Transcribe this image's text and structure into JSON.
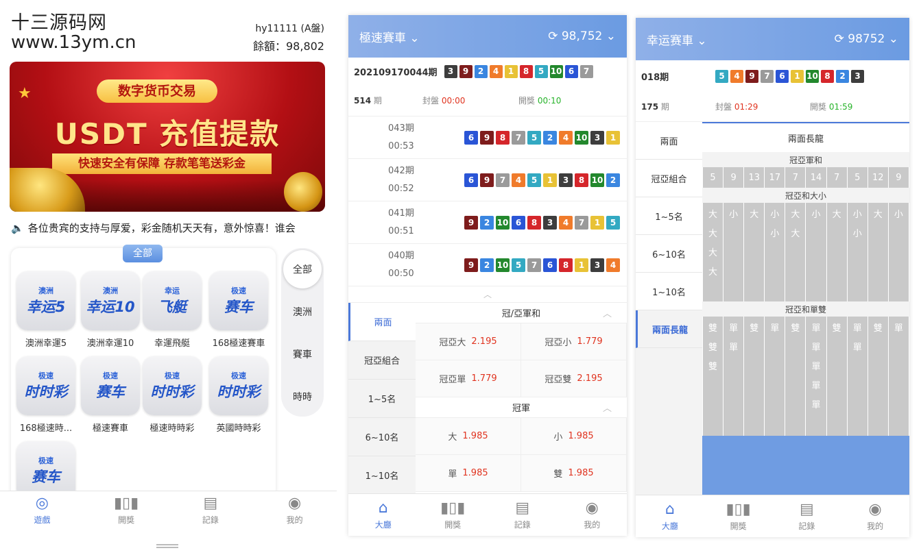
{
  "p1": {
    "wm_line1": "十三源码网",
    "wm_line2": "www.13ym.cn",
    "username": "hy11111 (A盤)",
    "balance": "餘額：98,802",
    "banner": {
      "tag": "数字货币交易",
      "title": "USDT 充值提款",
      "sub": "快速安全有保障 存款笔笔送彩金"
    },
    "notice": "各位贵宾的支持与厚爱，彩金随机天天有，意外惊喜！谁会",
    "all_badge": "全部",
    "games": [
      {
        "t1": "澳洲",
        "t2": "幸运5",
        "label": "澳洲幸運5"
      },
      {
        "t1": "澳洲",
        "t2": "幸运10",
        "label": "澳洲幸運10"
      },
      {
        "t1": "幸运",
        "t2": "飞艇",
        "label": "幸運飛艇"
      },
      {
        "t1": "极速",
        "t2": "赛车",
        "label": "168極速賽車"
      },
      {
        "t1": "极速",
        "t2": "时时彩",
        "label": "168極速時..."
      },
      {
        "t1": "极速",
        "t2": "赛车",
        "label": "極速賽車"
      },
      {
        "t1": "极速",
        "t2": "时时彩",
        "label": "極速時時彩"
      },
      {
        "t1": "极速",
        "t2": "时时彩",
        "label": "英國時時彩"
      },
      {
        "t1": "极速",
        "t2": "赛车",
        "label": ""
      }
    ],
    "rnav": [
      "全部",
      "澳洲",
      "賽車",
      "時時"
    ],
    "tabs": [
      "遊戲",
      "開獎",
      "記錄",
      "我的"
    ]
  },
  "p2": {
    "title": "極速賽車",
    "balance": "98,752",
    "period": "202109170044期",
    "draw": [
      3,
      9,
      2,
      4,
      1,
      8,
      5,
      10,
      6,
      7
    ],
    "cur_period": "514",
    "cur_unit": "期",
    "close_label": "封盤",
    "close_time": "00:00",
    "open_label": "開獎",
    "open_time": "00:10",
    "history": [
      {
        "p": "043期",
        "t": "00:53",
        "n": [
          6,
          9,
          8,
          7,
          5,
          2,
          4,
          10,
          3,
          1
        ]
      },
      {
        "p": "042期",
        "t": "00:52",
        "n": [
          6,
          9,
          7,
          4,
          5,
          1,
          3,
          8,
          10,
          2
        ]
      },
      {
        "p": "041期",
        "t": "00:51",
        "n": [
          9,
          2,
          10,
          6,
          8,
          3,
          4,
          7,
          1,
          5
        ]
      },
      {
        "p": "040期",
        "t": "00:50",
        "n": [
          9,
          2,
          10,
          5,
          7,
          6,
          8,
          1,
          3,
          4
        ]
      }
    ],
    "side": [
      "兩面",
      "冠亞組合",
      "1~5名",
      "6~10名",
      "1~10名"
    ],
    "sec1": "冠/亞軍和",
    "odds1": [
      {
        "k": "冠亞大",
        "v": "2.195"
      },
      {
        "k": "冠亞小",
        "v": "1.779"
      },
      {
        "k": "冠亞單",
        "v": "1.779"
      },
      {
        "k": "冠亞雙",
        "v": "2.195"
      }
    ],
    "sec2": "冠軍",
    "odds2": [
      {
        "k": "大",
        "v": "1.985"
      },
      {
        "k": "小",
        "v": "1.985"
      },
      {
        "k": "單",
        "v": "1.985"
      },
      {
        "k": "雙",
        "v": "1.985"
      }
    ],
    "tabs": [
      "大廳",
      "開獎",
      "記錄",
      "我的"
    ]
  },
  "p3": {
    "title": "幸运赛車",
    "balance": "98752",
    "period": "018期",
    "draw": [
      5,
      4,
      9,
      7,
      6,
      1,
      10,
      8,
      2,
      3
    ],
    "cur_period": "175",
    "cur_unit": "期",
    "close_label": "封盤",
    "close_time": "01:29",
    "open_label": "開獎",
    "open_time": "01:59",
    "side": [
      "兩面",
      "冠亞組合",
      "1~5名",
      "6~10名",
      "1~10名",
      "兩面長龍"
    ],
    "long_title": "兩面長龍",
    "sec_sum": "冠亞軍和",
    "sum_vals": [
      "5",
      "9",
      "13",
      "17",
      "7",
      "14",
      "7",
      "5",
      "12",
      "9"
    ],
    "sec_bs": "冠亞和大小",
    "bs_cols": [
      [
        "大",
        "大",
        "大",
        "大"
      ],
      [
        "小"
      ],
      [
        "大"
      ],
      [
        "小",
        "小"
      ],
      [
        "大",
        "大"
      ],
      [
        "小"
      ],
      [
        "大"
      ],
      [
        "小",
        "小"
      ],
      [
        "大"
      ],
      [
        "小"
      ]
    ],
    "sec_oe": "冠亞和單雙",
    "oe_cols": [
      [
        "雙",
        "雙",
        "雙"
      ],
      [
        "單",
        "單"
      ],
      [
        "雙"
      ],
      [
        "單"
      ],
      [
        "雙"
      ],
      [
        "單",
        "單",
        "單",
        "單",
        "單"
      ],
      [
        "雙"
      ],
      [
        "單",
        "單"
      ],
      [
        "雙"
      ],
      [
        "單"
      ]
    ],
    "tabs": [
      "大廳",
      "開獎",
      "記錄",
      "我的"
    ]
  }
}
